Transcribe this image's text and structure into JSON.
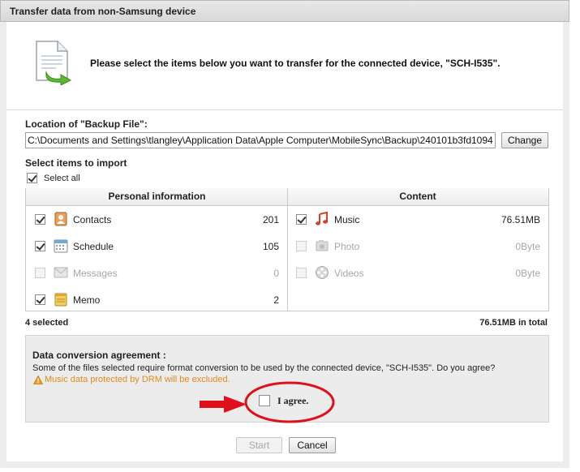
{
  "window": {
    "title": "Transfer data from non-Samsung device"
  },
  "header": {
    "prompt": "Please select the items below you want to transfer for the connected device, \"SCH-I535\"."
  },
  "backup": {
    "label": "Location of \"Backup File\":",
    "path": "C:\\Documents and Settings\\tlangley\\Application Data\\Apple Computer\\MobileSync\\Backup\\240101b3fd1094",
    "change_label": "Change"
  },
  "select": {
    "label": "Select items to import",
    "select_all_label": "Select all",
    "select_all_checked": true
  },
  "personal": {
    "header": "Personal information",
    "items": [
      {
        "label": "Contacts",
        "count": "201",
        "checked": true,
        "enabled": true,
        "icon": "contacts-icon"
      },
      {
        "label": "Schedule",
        "count": "105",
        "checked": true,
        "enabled": true,
        "icon": "calendar-icon"
      },
      {
        "label": "Messages",
        "count": "0",
        "checked": false,
        "enabled": false,
        "icon": "message-icon"
      },
      {
        "label": "Memo",
        "count": "2",
        "checked": true,
        "enabled": true,
        "icon": "memo-icon"
      }
    ]
  },
  "content": {
    "header": "Content",
    "items": [
      {
        "label": "Music",
        "size": "76.51MB",
        "checked": true,
        "enabled": true,
        "icon": "music-note-icon"
      },
      {
        "label": "Photo",
        "size": "0Byte",
        "checked": false,
        "enabled": false,
        "icon": "photo-icon"
      },
      {
        "label": "Videos",
        "size": "0Byte",
        "checked": false,
        "enabled": false,
        "icon": "film-reel-icon"
      }
    ]
  },
  "summary": {
    "selected": "4 selected",
    "total": "76.51MB in total"
  },
  "agreement": {
    "title": "Data conversion agreement :",
    "text": "Some of the files selected require format conversion to be used by the connected device, \"SCH-I535\". Do you agree?",
    "warning": "Music data protected by DRM will be excluded.",
    "agree_label": "I agree.",
    "agree_checked": false
  },
  "buttons": {
    "start_label": "Start",
    "cancel_label": "Cancel"
  },
  "colors": {
    "warning": "#e08a1e",
    "annotation": "#e0101a"
  }
}
